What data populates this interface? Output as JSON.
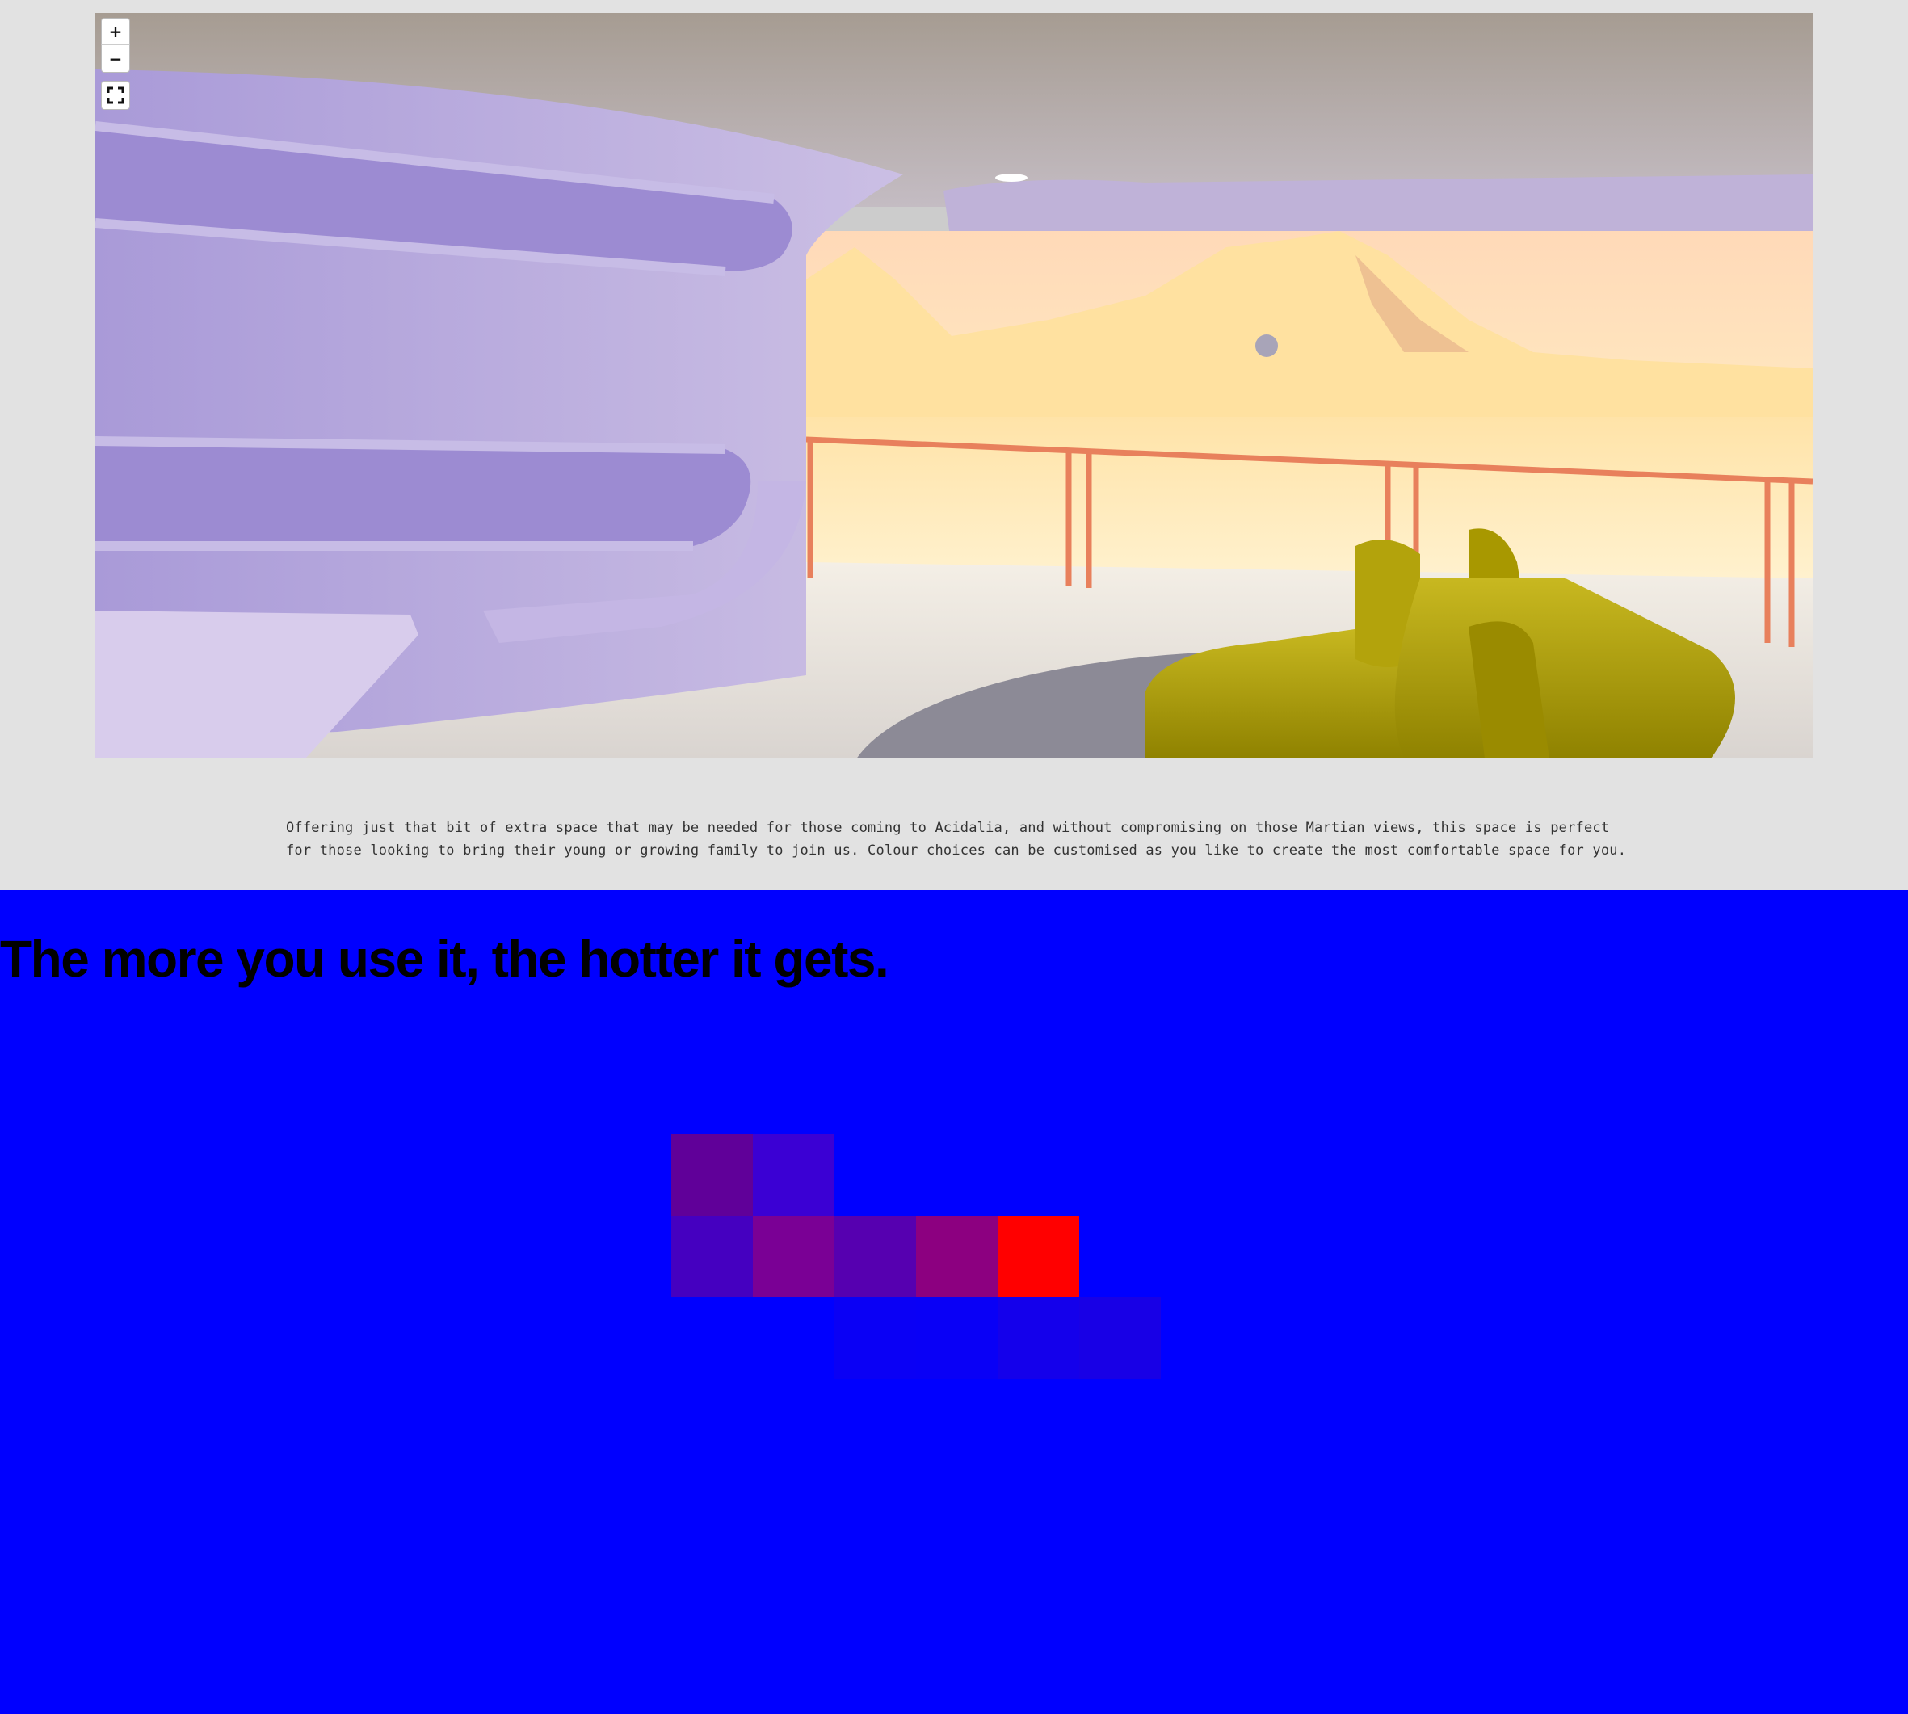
{
  "viewer": {
    "zoom_in_label": "+",
    "zoom_out_label": "−",
    "fullscreen_icon": "fullscreen-icon"
  },
  "description": "Offering just that bit of extra space that may be needed for those coming to Acidalia, and without compromising on those Martian views, this space is perfect for those looking to bring their young or growing family to join us. Colour choices can be customised as you like to create the most comfortable space for you.",
  "heading": "The more you use it, the hotter it gets.",
  "colors": {
    "page_background": "#e2e2e2",
    "heatmap_background": "#0000ff",
    "hot": "#ff0000"
  },
  "heatmap_cells": [
    {
      "col": 0,
      "row": 0,
      "color": "#600099"
    },
    {
      "col": 1,
      "row": 0,
      "color": "#3b00d4"
    },
    {
      "col": 0,
      "row": 1,
      "color": "#4500c0"
    },
    {
      "col": 1,
      "row": 1,
      "color": "#7a0095"
    },
    {
      "col": 2,
      "row": 1,
      "color": "#5600b0"
    },
    {
      "col": 3,
      "row": 1,
      "color": "#8c0080"
    },
    {
      "col": 4,
      "row": 1,
      "color": "#ff0000"
    },
    {
      "col": 2,
      "row": 2,
      "color": "#0a00f5"
    },
    {
      "col": 3,
      "row": 2,
      "color": "#0900f6"
    },
    {
      "col": 4,
      "row": 2,
      "color": "#1400eb"
    },
    {
      "col": 5,
      "row": 2,
      "color": "#1800e6"
    }
  ]
}
